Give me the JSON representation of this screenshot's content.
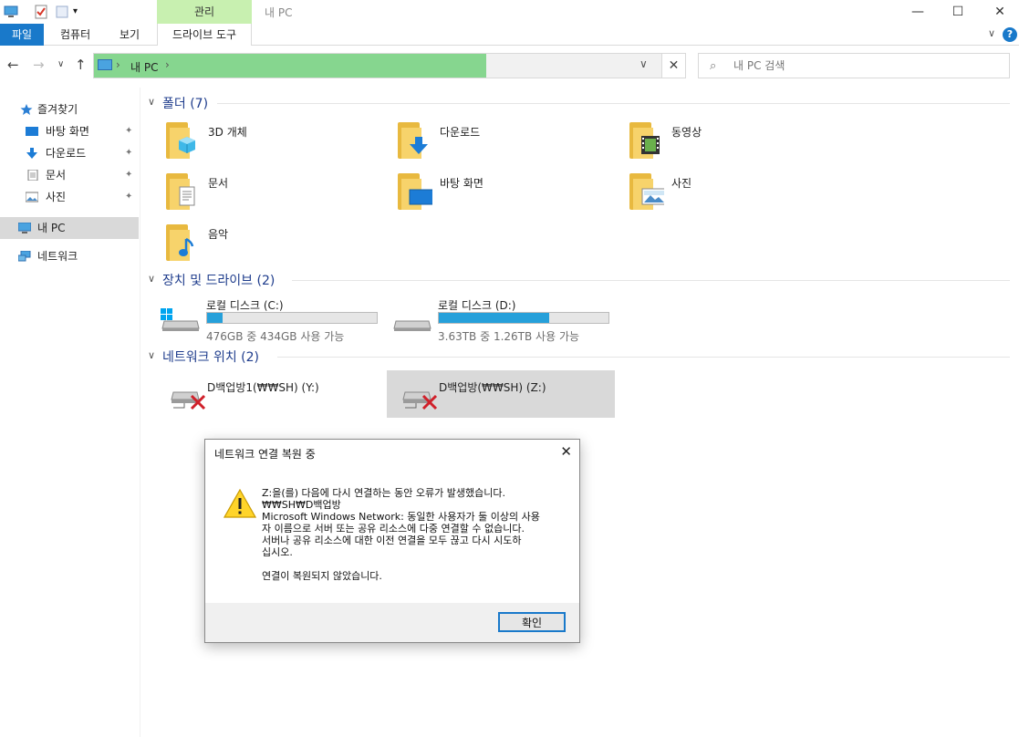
{
  "window": {
    "title": "내 PC",
    "context_group": "관리",
    "minimize_glyph": "—",
    "maximize_glyph": "☐",
    "close_glyph": "✕"
  },
  "ribbon": {
    "tabs": [
      {
        "label": "파일"
      },
      {
        "label": "컴퓨터"
      },
      {
        "label": "보기"
      },
      {
        "label": "드라이브 도구"
      }
    ],
    "expand_glyph": "∨",
    "help_glyph": "?"
  },
  "nav": {
    "back": "←",
    "forward": "→",
    "recent": "∨",
    "up": "↑",
    "crumbs": [
      "내 PC"
    ],
    "sep": "›",
    "dropdown": "∨",
    "refresh": "✕"
  },
  "search": {
    "placeholder": "내 PC 검색",
    "icon": "⌕"
  },
  "sidebar": {
    "items": [
      {
        "label": "즐겨찾기",
        "icon": "star-icon"
      },
      {
        "label": "바탕 화면",
        "icon": "desktop-icon",
        "pinned": true
      },
      {
        "label": "다운로드",
        "icon": "download-icon",
        "pinned": true
      },
      {
        "label": "문서",
        "icon": "document-icon",
        "pinned": true
      },
      {
        "label": "사진",
        "icon": "picture-icon",
        "pinned": true
      },
      {
        "label": "내 PC",
        "icon": "computer-icon",
        "selected": true
      },
      {
        "label": "네트워크",
        "icon": "network-icon"
      }
    ],
    "pin_glyph": "📌"
  },
  "groups": {
    "folders": {
      "title": "폴더 (7)",
      "items": [
        {
          "label": "3D 개체",
          "icon": "3d-objects-icon"
        },
        {
          "label": "다운로드",
          "icon": "download-icon"
        },
        {
          "label": "동영상",
          "icon": "video-icon"
        },
        {
          "label": "문서",
          "icon": "document-icon"
        },
        {
          "label": "바탕 화면",
          "icon": "desktop-icon"
        },
        {
          "label": "사진",
          "icon": "picture-icon"
        },
        {
          "label": "음악",
          "icon": "music-icon"
        }
      ]
    },
    "drives": {
      "title": "장치 및 드라이브 (2)",
      "items": [
        {
          "name": "로컬 디스크 (C:)",
          "free_text": "476GB 중 434GB 사용 가능",
          "used_fraction": 0.09,
          "icon": "system-drive-icon"
        },
        {
          "name": "로컬 디스크 (D:)",
          "free_text": "3.63TB 중 1.26TB 사용 가능",
          "used_fraction": 0.65,
          "icon": "drive-icon"
        }
      ]
    },
    "network": {
      "title": "네트워크 위치 (2)",
      "items": [
        {
          "name": "D백업방1(₩₩SH) (Y:)",
          "icon": "disconnected-network-drive-icon"
        },
        {
          "name": "D백업방(₩₩SH) (Z:)",
          "icon": "disconnected-network-drive-icon",
          "selected": true
        }
      ]
    }
  },
  "dialog": {
    "title": "네트워크 연결 복원 중",
    "close_glyph": "✕",
    "message": "Z:을(를) 다음에 다시 연결하는 동안 오류가 발생했습니다.\n₩₩SH₩D백업방\nMicrosoft Windows Network: 동일한 사용자가 둘 이상의 사용\n자 이름으로 서버 또는 공유 리소스에 다중 연결할 수 없습니다.\n서버나 공유 리소스에 대한 이전 연결을 모두 끊고 다시 시도하\n십시오.",
    "footer_message": "연결이 복원되지 않았습니다.",
    "ok_label": "확인"
  }
}
